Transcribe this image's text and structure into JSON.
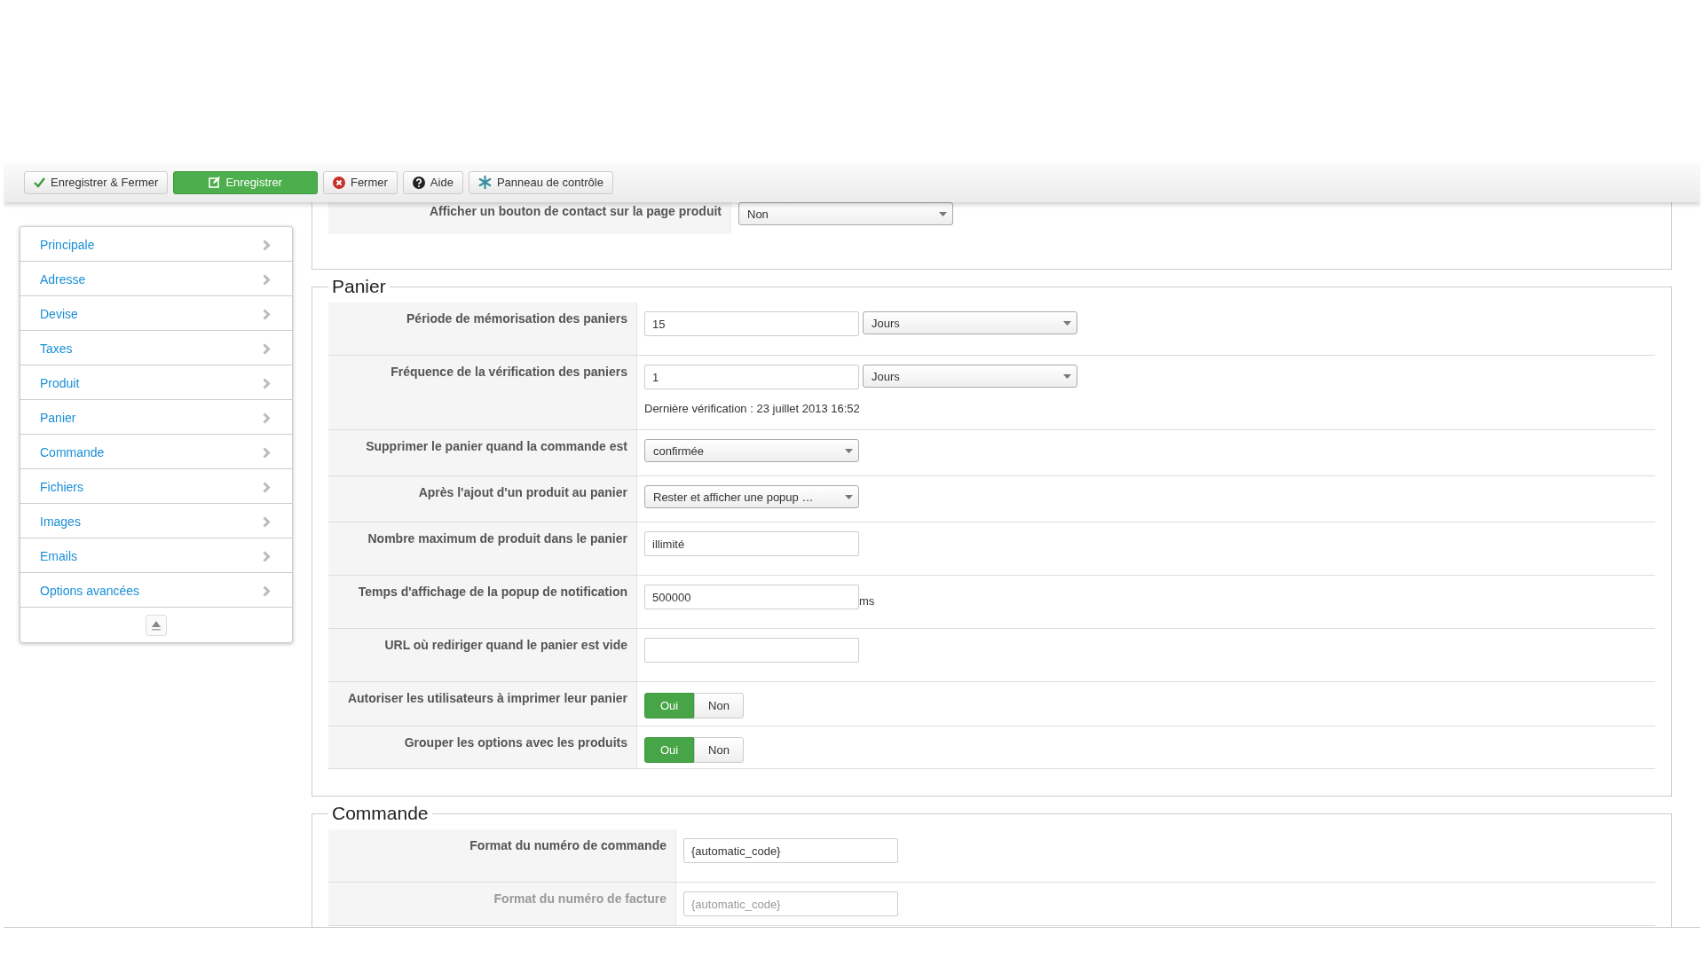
{
  "toolbar": {
    "buttons": [
      {
        "label": "Enregistrer & Fermer",
        "kind": "default"
      },
      {
        "label": "Enregistrer",
        "kind": "success"
      },
      {
        "label": "Fermer",
        "kind": "default"
      },
      {
        "label": "Aide",
        "kind": "default"
      },
      {
        "label": "Panneau de contrôle",
        "kind": "default"
      }
    ]
  },
  "sidebar": {
    "items": [
      {
        "label": "Principale"
      },
      {
        "label": "Adresse"
      },
      {
        "label": "Devise"
      },
      {
        "label": "Taxes"
      },
      {
        "label": "Produit"
      },
      {
        "label": "Panier"
      },
      {
        "label": "Commande"
      },
      {
        "label": "Fichiers"
      },
      {
        "label": "Images"
      },
      {
        "label": "Emails"
      },
      {
        "label": "Options avancées"
      }
    ]
  },
  "sections": [
    {
      "fields": [
        {
          "kind": "select",
          "label": "Afficher un bouton de contact sur la page produit",
          "value": "Non"
        }
      ]
    },
    {
      "legend": "Panier",
      "fields": [
        {
          "kind": "text_select",
          "label": "Période de mémorisation des paniers",
          "value": "15",
          "unit": "Jours"
        },
        {
          "kind": "text_select",
          "label": "Fréquence de la vérification des paniers",
          "value": "1",
          "unit": "Jours",
          "note": "Dernière vérification : 23 juillet 2013 16:52"
        },
        {
          "kind": "select",
          "label": "Supprimer le panier quand la commande est",
          "value": "confirmée"
        },
        {
          "kind": "select",
          "label": "Après l'ajout d'un produit au panier",
          "value": "Rester et afficher une popup …"
        },
        {
          "kind": "text",
          "label": "Nombre maximum de produit dans le panier",
          "value": "illimité"
        },
        {
          "kind": "text",
          "label": "Temps d'affichage de la popup de notification",
          "value": "500000",
          "suffix": "ms"
        },
        {
          "kind": "text",
          "label": "URL où rediriger quand le panier est vide"
        },
        {
          "kind": "toggle",
          "label": "Autoriser les utilisateurs à imprimer leur panier",
          "options": [
            {
              "label": "Oui",
              "selected": true
            },
            {
              "label": "Non",
              "selected": false
            }
          ]
        },
        {
          "kind": "toggle",
          "label": "Grouper les options avec les produits",
          "options": [
            {
              "label": "Oui",
              "selected": true
            },
            {
              "label": "Non",
              "selected": false
            }
          ]
        }
      ]
    },
    {
      "legend": "Commande",
      "fields": [
        {
          "kind": "text",
          "label": "Format du numéro de commande",
          "value": "{automatic_code}",
          "disabled": false
        },
        {
          "kind": "text",
          "label": "Format du numéro de facture",
          "value": "{automatic_code}",
          "disabled": true
        }
      ]
    }
  ]
}
